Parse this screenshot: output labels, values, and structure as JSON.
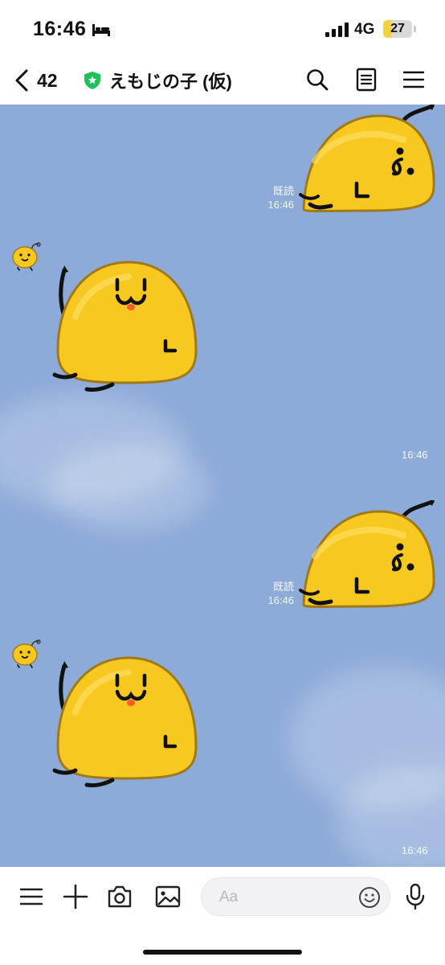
{
  "status_bar": {
    "time": "16:46",
    "network": "4G",
    "battery_level": "27",
    "battery_fraction": 0.27
  },
  "header": {
    "back_count": "42",
    "title": "えもじの子 (仮)",
    "icons": [
      "chevron-left-icon",
      "shield-star-icon",
      "search-icon",
      "notes-icon",
      "menu-icon"
    ]
  },
  "messages": [
    {
      "side": "right",
      "read_label": "既読",
      "time": "16:46",
      "sticker": "yellow-blob-lying-sticker"
    },
    {
      "side": "left",
      "time": "16:46",
      "sticker": "yellow-blob-waving-sticker"
    },
    {
      "side": "right",
      "read_label": "既読",
      "time": "16:46",
      "sticker": "yellow-blob-lying-sticker"
    },
    {
      "side": "left",
      "time": "16:46",
      "sticker": "yellow-blob-waving-sticker"
    }
  ],
  "input_bar": {
    "placeholder": "Aa",
    "icons": [
      "menu-icon",
      "plus-icon",
      "camera-icon",
      "image-icon",
      "emoji-icon",
      "microphone-icon"
    ]
  },
  "colors": {
    "chat_background": "#8dabd9",
    "sticker_yellow": "#f7c81f",
    "sticker_outline": "#a07a1a",
    "battery_fill": "#f6d23a",
    "shield_green": "#1fbf5a"
  }
}
